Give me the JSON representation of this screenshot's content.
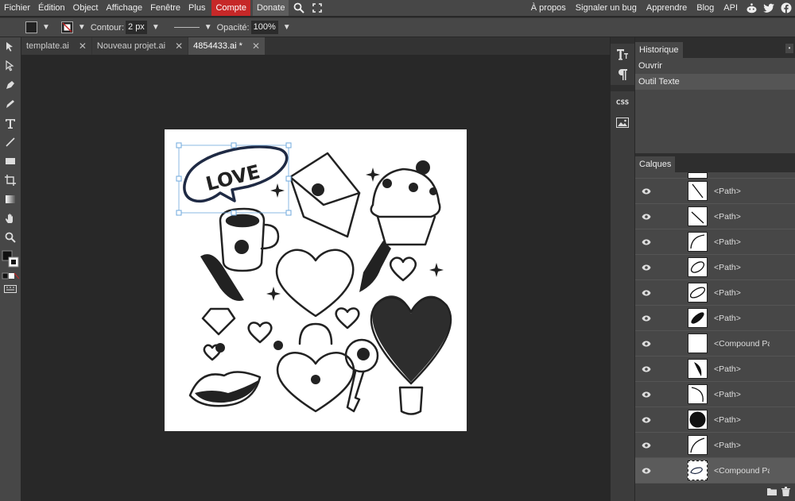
{
  "menubar": {
    "items": [
      "Fichier",
      "Édition",
      "Object",
      "Affichage",
      "Fenêtre",
      "Plus"
    ],
    "compte": "Compte",
    "donate": "Donate",
    "right_items": [
      "À propos",
      "Signaler un bug",
      "Apprendre",
      "Blog",
      "API"
    ]
  },
  "options": {
    "contour_label": "Contour:",
    "contour_value": "2 px",
    "opacity_label": "Opacité:",
    "opacity_value": "100%"
  },
  "tabs": [
    {
      "label": "template.ai"
    },
    {
      "label": "Nouveau projet.ai"
    },
    {
      "label": "4854433.ai *"
    }
  ],
  "historique": {
    "title": "Historique",
    "items": [
      "Ouvrir",
      "Outil Texte"
    ]
  },
  "calques": {
    "title": "Calques",
    "layers": [
      "<Path>",
      "<Path>",
      "<Path>",
      "<Path>",
      "<Path>",
      "<Path>",
      "<Compound Pa",
      "<Path>",
      "<Path>",
      "<Path>",
      "<Path>",
      "<Compound Pa"
    ]
  },
  "canvas_text": "LOVE",
  "colors": {
    "accent": "#c62828",
    "bg": "#282828",
    "panel": "#474747"
  }
}
